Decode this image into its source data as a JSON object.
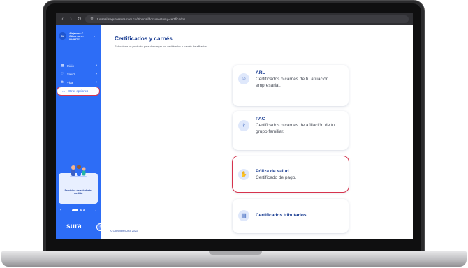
{
  "browser": {
    "url": "tucanal.segurossura.com.co/#/portal/documentos-y-certificados"
  },
  "sidebar": {
    "user": {
      "initials": "AV",
      "name": "Alejandro C",
      "line2": "Otimo carr...",
      "line3": "00498762"
    },
    "items": [
      {
        "label": "Inicio",
        "icon": "home-icon",
        "glyph": "▦"
      },
      {
        "label": "Salud",
        "icon": "stethoscope-icon",
        "glyph": "♡"
      },
      {
        "label": "Vida",
        "icon": "heart-icon",
        "glyph": "❀"
      },
      {
        "label": "Otras opciones",
        "icon": "more-icon",
        "glyph": "…"
      }
    ],
    "promo": {
      "text": "Servicios de salud a tu medida"
    },
    "brand": "sura"
  },
  "main": {
    "title": "Certificados y carnés",
    "subtitle": "Selecciona un producto para descargar tus certificados o carnés de afiliación",
    "cards": [
      {
        "title": "ARL",
        "desc": "Certificados o carnés de tu afiliación empresarial.",
        "icon": "worker-icon",
        "glyph": "☺"
      },
      {
        "title": "PAC",
        "desc": "Certificados o carnés de afiliación de tu grupo familiar.",
        "icon": "health-icon",
        "glyph": "⚕"
      },
      {
        "title": "Póliza de salud",
        "desc": "Certificado de pago.",
        "icon": "hand-coin-icon",
        "glyph": "✋"
      },
      {
        "title": "Certificados tributarios",
        "desc": "",
        "icon": "document-icon",
        "glyph": "▤"
      }
    ],
    "copyright": "© Copyright SURA 2023"
  },
  "colors": {
    "brand_blue": "#2d6df6",
    "title_blue": "#1c3f93",
    "highlight_red": "#d6334d"
  }
}
